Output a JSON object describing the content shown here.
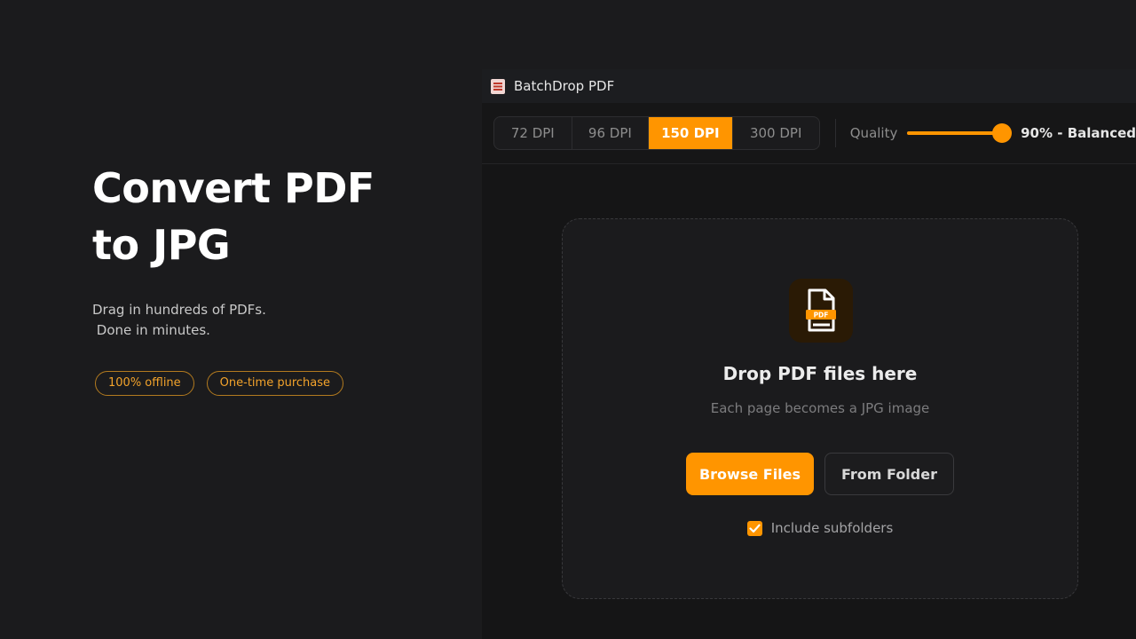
{
  "hero": {
    "title_line1": "Convert PDF",
    "title_line2": "to JPG",
    "subtitle_line1": "Drag in hundreds of PDFs.",
    "subtitle_line2": " Done in minutes.",
    "badges": [
      "100% offline",
      "One-time purchase"
    ]
  },
  "app": {
    "title": "BatchDrop PDF",
    "icon": "pdf-document-icon"
  },
  "toolbar": {
    "dpi_options": [
      "72 DPI",
      "96 DPI",
      "150 DPI",
      "300 DPI"
    ],
    "dpi_selected": "150 DPI",
    "quality_label": "Quality",
    "quality_percent": 90,
    "quality_value": "90% - Balanced"
  },
  "dropzone": {
    "icon": "pdf-file-icon",
    "icon_badge": "PDF",
    "title": "Drop PDF files here",
    "subtitle": "Each page becomes a JPG image",
    "browse_label": "Browse Files",
    "folder_label": "From Folder",
    "include_subfolders_label": "Include subfolders",
    "include_subfolders_checked": true
  },
  "colors": {
    "accent": "#ff9500",
    "background": "#1b1b1d",
    "badge_border": "#b27a1f"
  }
}
